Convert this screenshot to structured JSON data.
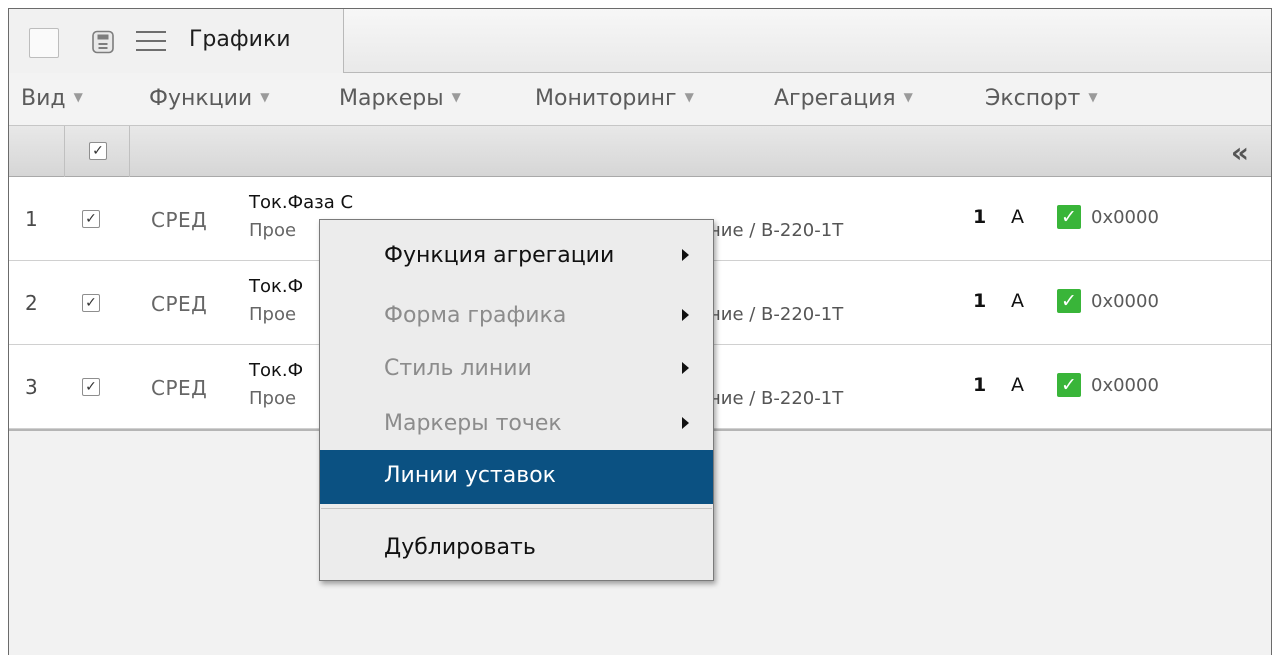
{
  "tab": {
    "label": "Графики"
  },
  "menubar": {
    "items": [
      {
        "label": "Вид"
      },
      {
        "label": "Функции"
      },
      {
        "label": "Маркеры"
      },
      {
        "label": "Мониторинг"
      },
      {
        "label": "Агрегация"
      },
      {
        "label": "Экспорт"
      }
    ]
  },
  "table": {
    "header_collapse_icon": "double-chevron-left-icon",
    "rows": [
      {
        "index": "1",
        "func": "СРЕД",
        "name": "Ток.Фаза С",
        "source": "Прое",
        "path": "ние / В-220-1Т",
        "unit_value": "1",
        "unit": "А",
        "hex": "0x0000"
      },
      {
        "index": "2",
        "func": "СРЕД",
        "name": "Ток.Ф",
        "source": "Прое",
        "path": "ние / В-220-1Т",
        "unit_value": "1",
        "unit": "А",
        "hex": "0x0000"
      },
      {
        "index": "3",
        "func": "СРЕД",
        "name": "Ток.Ф",
        "source": "Прое",
        "path": "ние / В-220-1Т",
        "unit_value": "1",
        "unit": "А",
        "hex": "0x0000"
      }
    ],
    "status_color": "#39b539"
  },
  "context_menu": {
    "highlight_color": "#0b5182",
    "items": [
      {
        "label": "Функция агрегации",
        "state": "enabled",
        "submenu": true
      },
      {
        "label": "Форма графика",
        "state": "disabled",
        "submenu": true
      },
      {
        "label": "Стиль линии",
        "state": "disabled",
        "submenu": true
      },
      {
        "label": "Маркеры точек",
        "state": "disabled",
        "submenu": true
      },
      {
        "label": "Линии уставок",
        "state": "highlight",
        "submenu": false
      },
      {
        "label": "Дублировать",
        "state": "enabled",
        "submenu": false
      }
    ]
  }
}
